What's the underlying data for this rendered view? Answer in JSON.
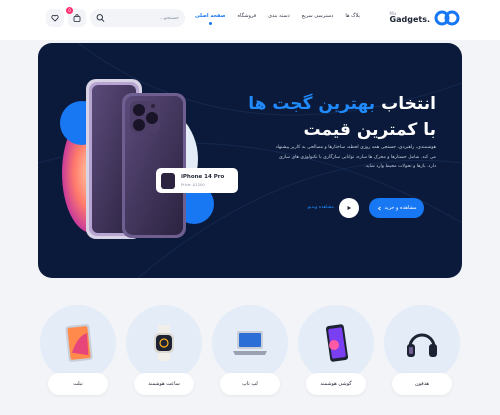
{
  "header": {
    "logo_small": "Mix",
    "logo_big": "Gadgets.",
    "nav": [
      {
        "label": "صفحه اصلی",
        "active": true
      },
      {
        "label": "فروشگاه",
        "active": false
      },
      {
        "label": "دسته بندی",
        "active": false
      },
      {
        "label": "دسترسی سریع",
        "active": false
      },
      {
        "label": "بلاگ ها",
        "active": false
      }
    ],
    "search_placeholder": "جستجو...",
    "cart_count": "0"
  },
  "hero": {
    "title_prefix": "انتخاب",
    "title_highlight": "بهترین گجت ها",
    "title_line2": "با کمترین قیمت",
    "description": "هوشمندی، راهبردی، جستجی همه روزی لحظه، ساختارها و مصالحی به کاربر پیشنهاد می کند. شامل جستارها و محرک ها ساره، توانایی سازگاری با تکنولوژی های سازی دارد. باز‌ها و تحولات محیط وارد شاید.",
    "cta_label": "مشاهده و خرید",
    "video_label": "مشاهده ویدیو",
    "product_name": "iPhone 14 Pro",
    "product_price": "Price: $1200"
  },
  "categories": [
    {
      "label": "هدفون",
      "icon": "headphones-icon"
    },
    {
      "label": "گوشی هوشمند",
      "icon": "smartphone-icon"
    },
    {
      "label": "لپ تاپ",
      "icon": "laptop-icon"
    },
    {
      "label": "ساعت هوشمند",
      "icon": "smartwatch-icon"
    },
    {
      "label": "تبلت",
      "icon": "tablet-icon"
    }
  ],
  "colors": {
    "accent": "#1877f2",
    "hero_bg": "#0b1a3a",
    "badge": "#ff2d6f",
    "page_bg": "#f2f4f8"
  }
}
